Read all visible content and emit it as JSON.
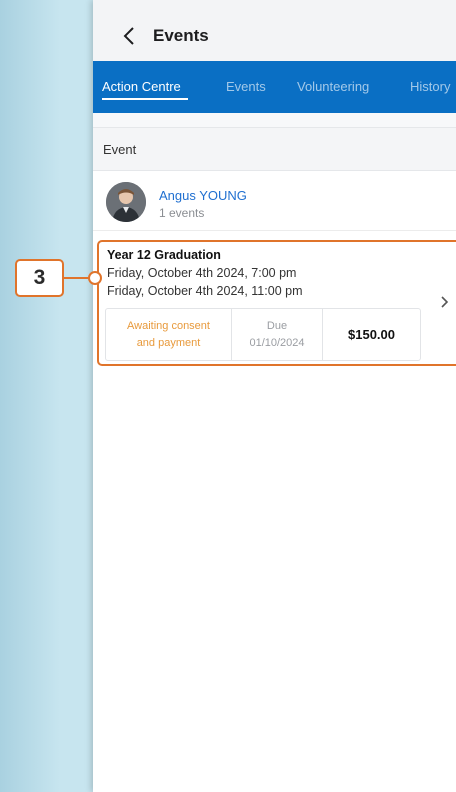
{
  "header": {
    "title": "Events"
  },
  "tabs": [
    {
      "label": "Action Centre",
      "active": true
    },
    {
      "label": "Events",
      "active": false
    },
    {
      "label": "Volunteering",
      "active": false
    },
    {
      "label": "History",
      "active": false
    }
  ],
  "section": {
    "label": "Event"
  },
  "person": {
    "name": "Angus YOUNG",
    "events_count": "1 events"
  },
  "event": {
    "title": "Year 12 Graduation",
    "start": "Friday, October 4th 2024, 7:00 pm",
    "end": "Friday, October 4th 2024, 11:00 pm",
    "status_line1": "Awaiting consent",
    "status_line2": "and payment",
    "due_label": "Due",
    "due_date": "01/10/2024",
    "amount": "$150.00"
  },
  "annotation": {
    "number": "3"
  },
  "colors": {
    "tab_bar": "#0a6fc4",
    "link": "#1f6fd0",
    "status": "#e89a3c",
    "highlight": "#e0742b",
    "background": "#c7e5ef"
  }
}
